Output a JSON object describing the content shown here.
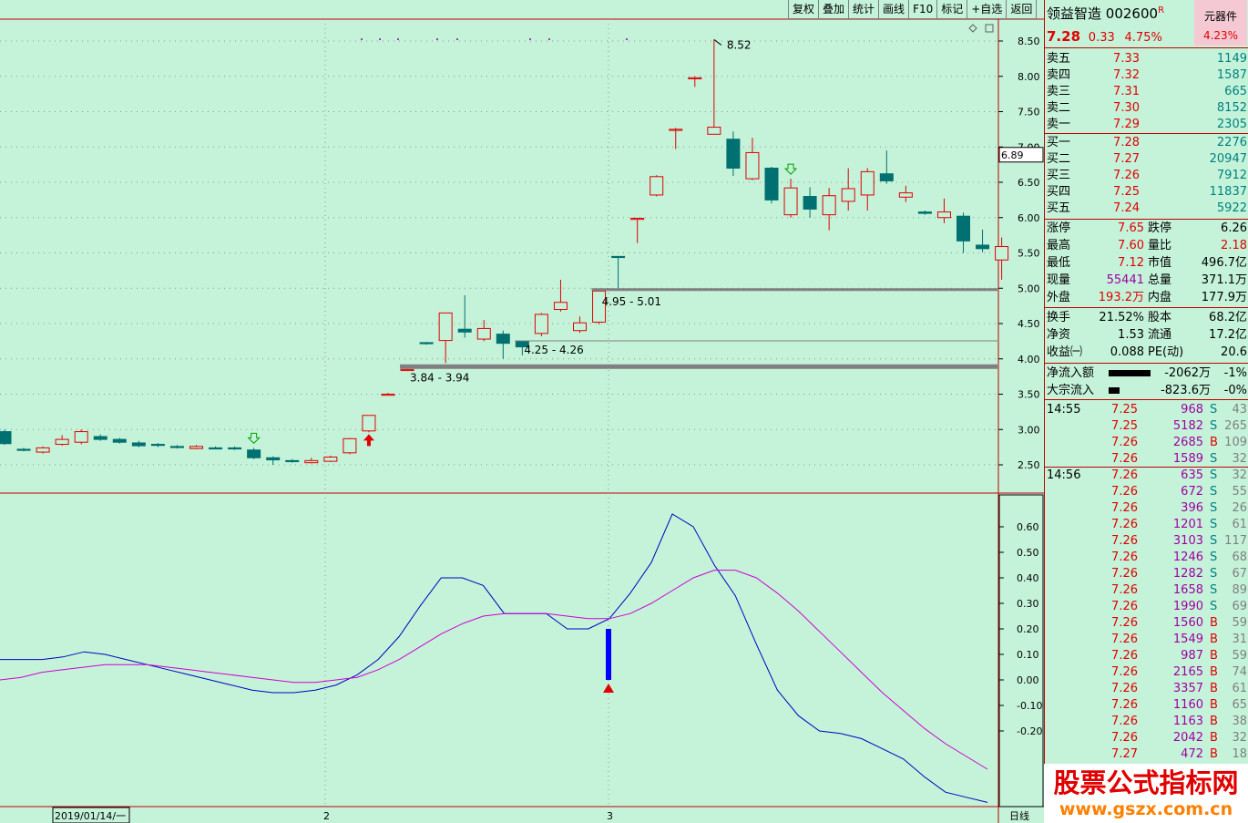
{
  "toolbar": {
    "items": [
      "复权",
      "叠加",
      "统计",
      "画线",
      "F10",
      "标记",
      "+自选",
      "返回"
    ]
  },
  "header": {
    "name": "领益智造",
    "code": "002600",
    "r_mark": "R",
    "price": "7.28",
    "change": "0.33",
    "pct": "4.75%",
    "plugin_label": "元器件",
    "plugin_pct": "4.23%"
  },
  "order_book": {
    "asks": [
      {
        "label": "卖五",
        "price": "7.33",
        "vol": "1149"
      },
      {
        "label": "卖四",
        "price": "7.32",
        "vol": "1587"
      },
      {
        "label": "卖三",
        "price": "7.31",
        "vol": "665"
      },
      {
        "label": "卖二",
        "price": "7.30",
        "vol": "8152"
      },
      {
        "label": "卖一",
        "price": "7.29",
        "vol": "2305"
      }
    ],
    "bids": [
      {
        "label": "买一",
        "price": "7.28",
        "vol": "2276"
      },
      {
        "label": "买二",
        "price": "7.27",
        "vol": "20947"
      },
      {
        "label": "买三",
        "price": "7.26",
        "vol": "7912"
      },
      {
        "label": "买四",
        "price": "7.25",
        "vol": "11837"
      },
      {
        "label": "买五",
        "price": "7.24",
        "vol": "5922"
      }
    ]
  },
  "stats": [
    {
      "k1": "涨停",
      "v1": "7.65",
      "k2": "跌停",
      "v2": "6.26"
    },
    {
      "k1": "最高",
      "v1": "7.60",
      "k2": "量比",
      "v2": "2.18"
    },
    {
      "k1": "最低",
      "v1": "7.12",
      "k2": "市值",
      "v2": "496.7亿"
    },
    {
      "k1": "现量",
      "v1": "55441",
      "k2": "总量",
      "v2": "371.1万"
    },
    {
      "k1": "外盘",
      "v1": "193.2万",
      "k2": "内盘",
      "v2": "177.9万"
    },
    {
      "k1": "换手",
      "v1": "21.52%",
      "k2": "股本",
      "v2": "68.2亿"
    },
    {
      "k1": "净资",
      "v1": "1.53",
      "k2": "流通",
      "v2": "17.2亿"
    },
    {
      "k1": "收益㈠",
      "v1": "0.088",
      "k2": "PE(动)",
      "v2": "20.6"
    }
  ],
  "flow": [
    {
      "label": "净流入额",
      "value": "-2062万",
      "pct": "-1%",
      "bar_fraction": 1.0
    },
    {
      "label": "大宗流入",
      "value": "-823.6万",
      "pct": "-0%",
      "bar_fraction": 0.25
    }
  ],
  "ticks": [
    {
      "time": "14:55",
      "price": "7.25",
      "vol": "968",
      "side": "S",
      "n": "43"
    },
    {
      "time": "",
      "price": "7.25",
      "vol": "5182",
      "side": "S",
      "n": "265"
    },
    {
      "time": "",
      "price": "7.26",
      "vol": "2685",
      "side": "B",
      "n": "109"
    },
    {
      "time": "",
      "price": "7.26",
      "vol": "1589",
      "side": "S",
      "n": "32"
    },
    {
      "time": "14:56",
      "price": "7.26",
      "vol": "635",
      "side": "S",
      "n": "32"
    },
    {
      "time": "",
      "price": "7.26",
      "vol": "672",
      "side": "S",
      "n": "55"
    },
    {
      "time": "",
      "price": "7.26",
      "vol": "396",
      "side": "S",
      "n": "26"
    },
    {
      "time": "",
      "price": "7.26",
      "vol": "1201",
      "side": "S",
      "n": "61"
    },
    {
      "time": "",
      "price": "7.26",
      "vol": "3103",
      "side": "S",
      "n": "117"
    },
    {
      "time": "",
      "price": "7.26",
      "vol": "1246",
      "side": "S",
      "n": "68"
    },
    {
      "time": "",
      "price": "7.26",
      "vol": "1282",
      "side": "S",
      "n": "67"
    },
    {
      "time": "",
      "price": "7.26",
      "vol": "1658",
      "side": "S",
      "n": "89"
    },
    {
      "time": "",
      "price": "7.26",
      "vol": "1990",
      "side": "S",
      "n": "69"
    },
    {
      "time": "",
      "price": "7.26",
      "vol": "1560",
      "side": "B",
      "n": "59"
    },
    {
      "time": "",
      "price": "7.26",
      "vol": "1549",
      "side": "B",
      "n": "31"
    },
    {
      "time": "",
      "price": "7.26",
      "vol": "987",
      "side": "B",
      "n": "59"
    },
    {
      "time": "",
      "price": "7.26",
      "vol": "2165",
      "side": "B",
      "n": "74"
    },
    {
      "time": "",
      "price": "7.26",
      "vol": "3357",
      "side": "B",
      "n": "61"
    },
    {
      "time": "",
      "price": "7.26",
      "vol": "1160",
      "side": "B",
      "n": "65"
    },
    {
      "time": "",
      "price": "7.26",
      "vol": "1163",
      "side": "B",
      "n": "38"
    },
    {
      "time": "",
      "price": "7.26",
      "vol": "2042",
      "side": "B",
      "n": "32"
    },
    {
      "time": "",
      "price": "7.27",
      "vol": "472",
      "side": "B",
      "n": "18"
    }
  ],
  "watermark": {
    "text1": "股票公式指标网",
    "text2": "www.gszx.com.cn"
  },
  "bottom": {
    "date": "2019/01/14/一",
    "m2": "2",
    "m3": "3",
    "period": "日线"
  },
  "chart_data": [
    {
      "type": "candlestick",
      "price_ticks": [
        "8.50",
        "8.00",
        "7.50",
        "7.00",
        "6.50",
        "6.00",
        "5.50",
        "5.00",
        "4.50",
        "4.00",
        "3.50",
        "3.00",
        "2.50"
      ],
      "ylim": [
        2.2,
        8.78
      ],
      "current_price_label": "6.89",
      "candles": [
        {
          "o": 2.97,
          "c": 2.8,
          "h": 3.0,
          "l": 2.78
        },
        {
          "o": 2.72,
          "c": 2.71,
          "h": 2.74,
          "l": 2.69
        },
        {
          "o": 2.68,
          "c": 2.74,
          "h": 2.76,
          "l": 2.66
        },
        {
          "o": 2.79,
          "c": 2.86,
          "h": 2.92,
          "l": 2.77
        },
        {
          "o": 2.82,
          "c": 2.97,
          "h": 3.0,
          "l": 2.79
        },
        {
          "o": 2.9,
          "c": 2.86,
          "h": 2.93,
          "l": 2.84
        },
        {
          "o": 2.86,
          "c": 2.82,
          "h": 2.88,
          "l": 2.8
        },
        {
          "o": 2.81,
          "c": 2.77,
          "h": 2.84,
          "l": 2.75
        },
        {
          "o": 2.79,
          "c": 2.78,
          "h": 2.81,
          "l": 2.75
        },
        {
          "o": 2.76,
          "c": 2.75,
          "h": 2.78,
          "l": 2.73
        },
        {
          "o": 2.73,
          "c": 2.76,
          "h": 2.78,
          "l": 2.72
        },
        {
          "o": 2.74,
          "c": 2.73,
          "h": 2.76,
          "l": 2.72
        },
        {
          "o": 2.74,
          "c": 2.73,
          "h": 2.76,
          "l": 2.71
        },
        {
          "o": 2.71,
          "c": 2.6,
          "h": 2.74,
          "l": 2.58
        },
        {
          "o": 2.6,
          "c": 2.57,
          "h": 2.62,
          "l": 2.5
        },
        {
          "o": 2.56,
          "c": 2.55,
          "h": 2.58,
          "l": 2.53
        },
        {
          "o": 2.53,
          "c": 2.56,
          "h": 2.6,
          "l": 2.52
        },
        {
          "o": 2.55,
          "c": 2.61,
          "h": 2.63,
          "l": 2.54
        },
        {
          "o": 2.67,
          "c": 2.87,
          "h": 2.88,
          "l": 2.65
        },
        {
          "o": 2.98,
          "c": 3.2,
          "h": 3.2,
          "l": 2.96
        },
        {
          "o": 3.49,
          "c": 3.5,
          "h": 3.52,
          "l": 3.48
        },
        {
          "o": 3.84,
          "c": 3.85,
          "h": 3.86,
          "l": 3.84
        },
        {
          "o": 4.23,
          "c": 4.22,
          "h": 4.24,
          "l": 4.2
        },
        {
          "o": 4.26,
          "c": 4.65,
          "h": 4.65,
          "l": 3.94
        },
        {
          "o": 4.42,
          "c": 4.38,
          "h": 4.9,
          "l": 4.3
        },
        {
          "o": 4.28,
          "c": 4.43,
          "h": 4.55,
          "l": 4.25
        },
        {
          "o": 4.35,
          "c": 4.22,
          "h": 4.4,
          "l": 4.0
        },
        {
          "o": 4.25,
          "c": 4.17,
          "h": 4.26,
          "l": 4.05
        },
        {
          "o": 4.36,
          "c": 4.63,
          "h": 4.65,
          "l": 4.32
        },
        {
          "o": 4.7,
          "c": 4.8,
          "h": 5.12,
          "l": 4.67
        },
        {
          "o": 4.4,
          "c": 4.51,
          "h": 4.6,
          "l": 4.37
        },
        {
          "o": 4.52,
          "c": 4.96,
          "h": 4.99,
          "l": 4.49
        },
        {
          "o": 5.45,
          "c": 5.44,
          "h": 5.45,
          "l": 4.97
        },
        {
          "o": 5.98,
          "c": 5.99,
          "h": 5.99,
          "l": 5.64
        },
        {
          "o": 6.32,
          "c": 6.58,
          "h": 6.6,
          "l": 6.3
        },
        {
          "o": 7.24,
          "c": 7.25,
          "h": 7.27,
          "l": 6.97
        },
        {
          "o": 7.97,
          "c": 7.98,
          "h": 8.0,
          "l": 7.85
        },
        {
          "o": 7.18,
          "c": 7.28,
          "h": 8.52,
          "l": 7.18
        },
        {
          "o": 7.11,
          "c": 6.7,
          "h": 7.22,
          "l": 6.59
        },
        {
          "o": 6.55,
          "c": 6.92,
          "h": 7.13,
          "l": 6.53
        },
        {
          "o": 6.7,
          "c": 6.25,
          "h": 6.72,
          "l": 6.2
        },
        {
          "o": 6.04,
          "c": 6.42,
          "h": 6.55,
          "l": 6.0
        },
        {
          "o": 6.3,
          "c": 6.12,
          "h": 6.43,
          "l": 6.0
        },
        {
          "o": 6.04,
          "c": 6.31,
          "h": 6.42,
          "l": 5.82
        },
        {
          "o": 6.23,
          "c": 6.41,
          "h": 6.7,
          "l": 6.1
        },
        {
          "o": 6.32,
          "c": 6.65,
          "h": 6.7,
          "l": 6.1
        },
        {
          "o": 6.62,
          "c": 6.52,
          "h": 6.95,
          "l": 6.48
        },
        {
          "o": 6.29,
          "c": 6.35,
          "h": 6.45,
          "l": 6.22
        },
        {
          "o": 6.08,
          "c": 6.06,
          "h": 6.1,
          "l": 6.04
        },
        {
          "o": 6.0,
          "c": 6.08,
          "h": 6.27,
          "l": 5.92
        },
        {
          "o": 6.02,
          "c": 5.67,
          "h": 6.07,
          "l": 5.5
        },
        {
          "o": 5.61,
          "c": 5.56,
          "h": 5.83,
          "l": 5.51
        },
        {
          "o": 5.4,
          "c": 5.59,
          "h": 5.72,
          "l": 5.12
        }
      ],
      "annotations": [
        {
          "text": "8.52",
          "price": 8.52,
          "index": 37
        },
        {
          "text": "4.95 - 5.01",
          "price": 4.98,
          "from_index": 31
        },
        {
          "text": "4.25 - 4.26",
          "price": 4.255,
          "from_index": 27
        },
        {
          "text": "3.84 - 3.94",
          "price": 3.89,
          "from_index": 21
        }
      ],
      "buy_arrow_index": 19,
      "down_arrow_indices": [
        13,
        41
      ]
    },
    {
      "type": "line",
      "yticks": [
        "0.60",
        "0.50",
        "0.40",
        "0.30",
        "0.20",
        "0.10",
        "0.00",
        "-0.10",
        "-0.20"
      ],
      "ylim": [
        -0.5,
        0.68
      ],
      "series": [
        {
          "color": "#0000c0",
          "values": [
            0.08,
            0.08,
            0.08,
            0.09,
            0.11,
            0.1,
            0.08,
            0.06,
            0.04,
            0.02,
            0.0,
            -0.02,
            -0.04,
            -0.05,
            -0.05,
            -0.04,
            -0.02,
            0.02,
            0.08,
            0.17,
            0.29,
            0.4,
            0.4,
            0.37,
            0.26,
            0.26,
            0.26,
            0.2,
            0.2,
            0.24,
            0.34,
            0.46,
            0.65,
            0.6,
            0.45,
            0.33,
            0.14,
            -0.04,
            -0.14,
            -0.2,
            -0.21,
            -0.23,
            -0.27,
            -0.31,
            -0.38,
            -0.44,
            -0.46,
            -0.48
          ]
        },
        {
          "color": "#d000d0",
          "values": [
            0.0,
            0.01,
            0.03,
            0.04,
            0.05,
            0.06,
            0.06,
            0.06,
            0.05,
            0.04,
            0.03,
            0.02,
            0.01,
            0.0,
            -0.01,
            -0.01,
            0.0,
            0.01,
            0.04,
            0.08,
            0.13,
            0.18,
            0.22,
            0.25,
            0.26,
            0.26,
            0.26,
            0.25,
            0.24,
            0.24,
            0.26,
            0.3,
            0.35,
            0.4,
            0.43,
            0.43,
            0.4,
            0.34,
            0.27,
            0.19,
            0.11,
            0.03,
            -0.05,
            -0.12,
            -0.19,
            -0.25,
            -0.3,
            -0.35
          ]
        }
      ],
      "signal_index": 31,
      "signal_range": [
        0.0,
        0.2
      ]
    }
  ]
}
